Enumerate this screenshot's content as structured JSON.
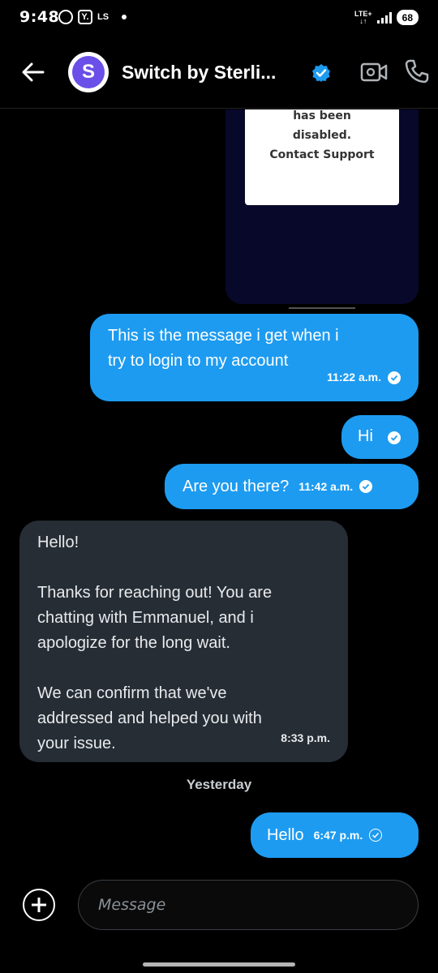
{
  "status_bar": {
    "time": "9:48",
    "y_label": "Y.",
    "ls_label": "LS",
    "lte_top": "LTE+",
    "lte_bottom": "↓↑",
    "battery": "68"
  },
  "header": {
    "contact_name": "Switch by Sterli...",
    "avatar_letter": "S",
    "accent": "#1d9bf0"
  },
  "shared_image": {
    "lines": [
      "has been",
      "disabled.",
      "Contact Support"
    ]
  },
  "messages": [
    {
      "direction": "out",
      "text_line1": "This is the message i get when i",
      "text_line2": "try to login to my account",
      "time": "11:22 a.m."
    },
    {
      "direction": "out",
      "text": "Hi"
    },
    {
      "direction": "out",
      "text": "Are you there?",
      "time": "11:42 a.m."
    },
    {
      "direction": "in",
      "paragraphs": [
        "Hello!",
        "Thanks for reaching out! You are",
        "chatting with Emmanuel, and i",
        "apologize for the long wait.",
        "We can confirm that we've",
        "addressed and helped you with",
        "your issue."
      ],
      "time": "8:33 p.m."
    },
    {
      "direction": "out",
      "text": "Hello",
      "time": "6:47 p.m."
    }
  ],
  "day_separator": "Yesterday",
  "composer": {
    "placeholder": "Message"
  }
}
